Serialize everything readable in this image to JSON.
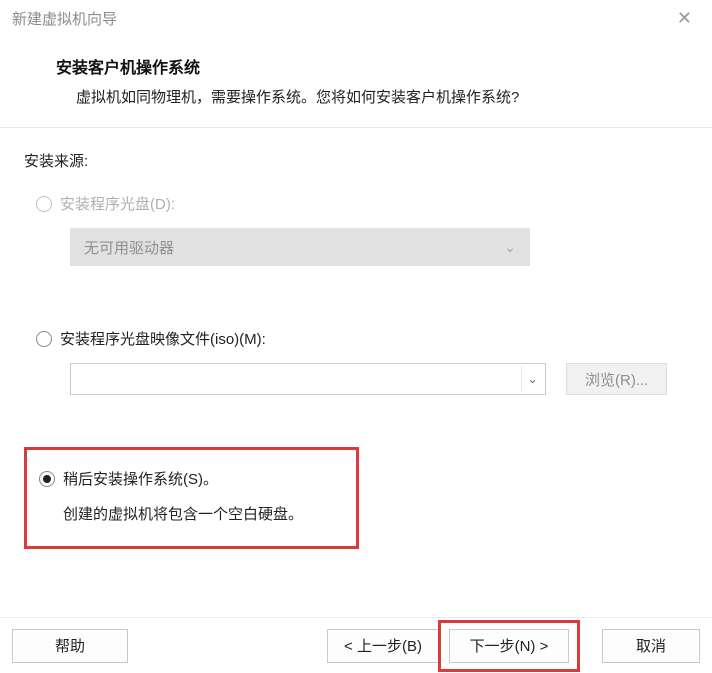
{
  "titlebar": {
    "title": "新建虚拟机向导",
    "close": "✕"
  },
  "header": {
    "title": "安装客户机操作系统",
    "description": "虚拟机如同物理机，需要操作系统。您将如何安装客户机操作系统?"
  },
  "source_label": "安装来源:",
  "opt_disc": {
    "label": "安装程序光盘(D):",
    "dropdown": "无可用驱动器"
  },
  "opt_iso": {
    "label": "安装程序光盘映像文件(iso)(M):",
    "browse": "浏览(R)..."
  },
  "opt_later": {
    "label": "稍后安装操作系统(S)。",
    "desc": "创建的虚拟机将包含一个空白硬盘。"
  },
  "footer": {
    "help": "帮助",
    "back": "< 上一步(B)",
    "next": "下一步(N) >",
    "cancel": "取消"
  }
}
